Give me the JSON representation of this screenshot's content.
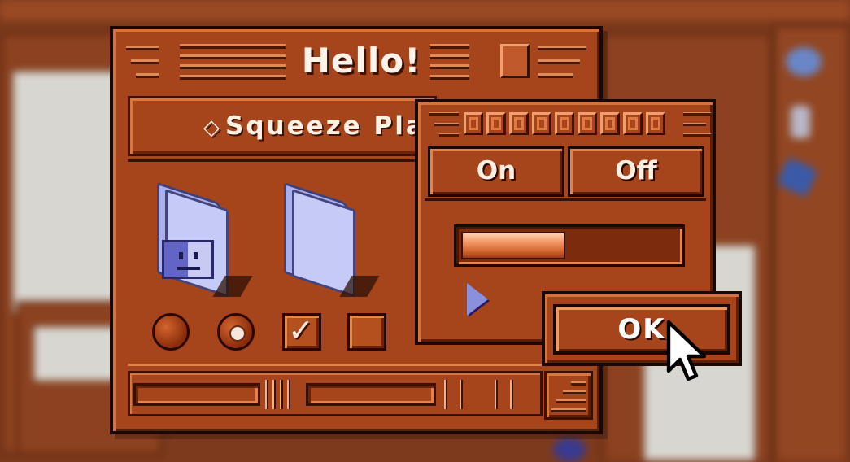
{
  "main_window": {
    "title": "Hello!",
    "platter_tab_label": "Squeeze Pla",
    "platter_tab_glyph": "◇",
    "folders": [
      {
        "icon": "finder-folder-icon"
      },
      {
        "icon": "plain-folder-icon"
      }
    ],
    "controls": {
      "radio_1_selected": false,
      "radio_2_selected": true,
      "checkbox_1_checked": true,
      "checkbox_2_checked": false
    }
  },
  "sub_window": {
    "segments": [
      {
        "label": "On"
      },
      {
        "label": "Off"
      }
    ],
    "progress_fraction": 0.48,
    "disclosure_icon": "disclosure-triangle-icon"
  },
  "ok_button": {
    "label": "OK"
  },
  "theme": {
    "window_color": "#a6441c",
    "accent_light": "#e08a55",
    "outline": "#1c0800",
    "folder_color": "#c6caf6"
  }
}
